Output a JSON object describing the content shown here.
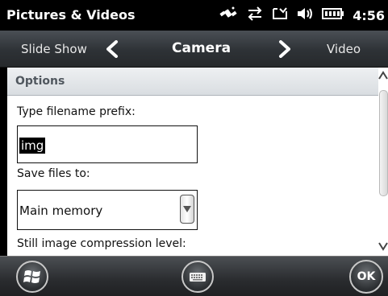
{
  "titlebar": {
    "title": "Pictures & Videos",
    "time": "4:56",
    "icons": [
      "satellite-icon",
      "data-sync-icon",
      "message-icon",
      "speaker-icon",
      "battery-icon"
    ]
  },
  "nav": {
    "prev_label": "Slide Show",
    "current_label": "Camera",
    "next_label": "Video"
  },
  "options": {
    "header": "Options",
    "filename_prefix_label": "Type filename prefix:",
    "filename_prefix_value": "img",
    "save_files_label": "Save files to:",
    "save_files_value": "Main memory",
    "compression_label": "Still image compression level:"
  },
  "bottombar": {
    "ok_label": "OK",
    "icons": [
      "windows-start-icon",
      "keyboard-icon"
    ]
  },
  "colors": {
    "accent": "#000000",
    "header_text": "#50575e",
    "navbar": "#2e3236"
  }
}
